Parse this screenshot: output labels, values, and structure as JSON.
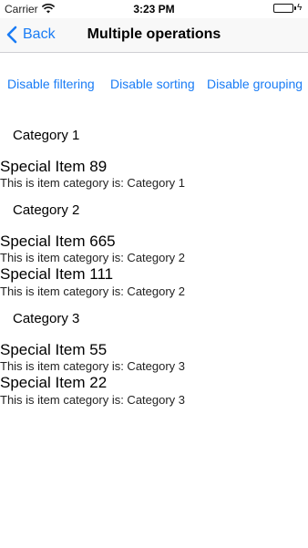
{
  "status": {
    "carrier": "Carrier",
    "time": "3:23 PM"
  },
  "nav": {
    "back_label": "Back",
    "title": "Multiple operations"
  },
  "actions": {
    "disable_filtering": "Disable filtering",
    "disable_sorting": "Disable sorting",
    "disable_grouping": "Disable grouping"
  },
  "groups": [
    {
      "header": "Category 1",
      "items": [
        {
          "title": "Special Item 89",
          "subtitle": "This is item category is: Category 1"
        }
      ]
    },
    {
      "header": "Category 2",
      "items": [
        {
          "title": "Special Item 665",
          "subtitle": "This is item category is: Category 2"
        },
        {
          "title": "Special Item 111",
          "subtitle": "This is item category is: Category 2"
        }
      ]
    },
    {
      "header": "Category 3",
      "items": [
        {
          "title": "Special Item 55",
          "subtitle": "This is item category is: Category 3"
        },
        {
          "title": "Special Item 22",
          "subtitle": "This is item category is: Category 3"
        }
      ]
    }
  ],
  "colors": {
    "accent": "#1a7cf5",
    "battery": "#4cd964"
  }
}
